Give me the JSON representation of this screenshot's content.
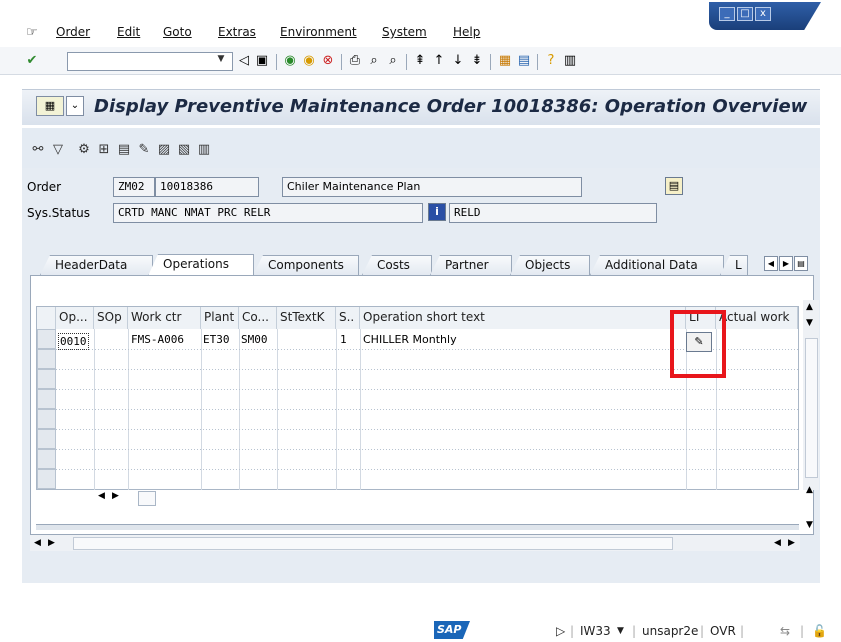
{
  "menu": {
    "items": [
      "Order",
      "Edit",
      "Goto",
      "Extras",
      "Environment",
      "System",
      "Help"
    ],
    "window_controls": [
      "_",
      "□",
      "x"
    ]
  },
  "toolbar": {
    "command_value": "",
    "icons": [
      "enter-icon",
      "back-icon",
      "save-icon",
      "back-green-icon",
      "exit-icon",
      "cancel-icon",
      "print-icon",
      "find-icon",
      "find-next-icon",
      "first-page-icon",
      "prev-page-icon",
      "next-page-icon",
      "last-page-icon",
      "new-session-icon",
      "shortcut-icon",
      "help-icon",
      "layout-icon"
    ]
  },
  "title": {
    "text": "Display Preventive Maintenance Order 10018386: Operation Overview"
  },
  "header": {
    "order_label": "Order",
    "order_type": "ZM02",
    "order_number": "10018386",
    "order_desc": "Chiler Maintenance Plan",
    "sys_status_label": "Sys.Status",
    "sys_status_value": "CRTD MANC NMAT PRC  RELR",
    "user_status_value": "RELD"
  },
  "tabs": [
    {
      "label": "HeaderData",
      "active": false
    },
    {
      "label": "Operations",
      "active": true
    },
    {
      "label": "Components",
      "active": false
    },
    {
      "label": "Costs",
      "active": false
    },
    {
      "label": "Partner",
      "active": false
    },
    {
      "label": "Objects",
      "active": false
    },
    {
      "label": "Additional Data",
      "active": false
    },
    {
      "label": "L",
      "active": false
    }
  ],
  "table": {
    "columns": [
      "Op...",
      "SOp",
      "Work ctr",
      "Plant",
      "Co...",
      "StTextK",
      "S..",
      "Operation short text",
      "LT",
      "Actual work"
    ],
    "rows": [
      {
        "op": "0010",
        "sop": "",
        "work_ctr": "FMS-A006",
        "plant": "ET30",
        "control_key": "SM00",
        "sttextk": "",
        "sys_cond": "1",
        "short_text": "CHILLER Monthly"
      }
    ]
  },
  "statusbar": {
    "logo": "SAP",
    "transaction": "IW33",
    "server": "unsapr2e",
    "mode": "OVR"
  }
}
